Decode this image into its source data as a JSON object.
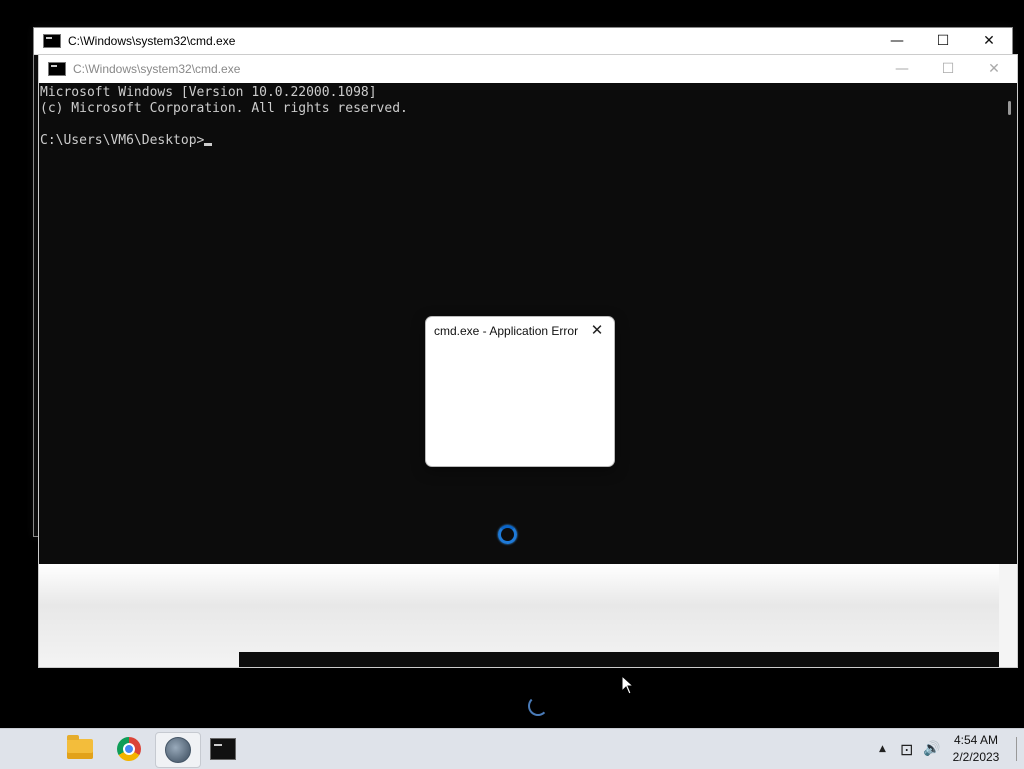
{
  "back_window": {
    "title": "C:\\Windows\\system32\\cmd.exe",
    "controls": {
      "minimize": "—",
      "maximize": "☐",
      "close": "✕"
    }
  },
  "front_window": {
    "title": "C:\\Windows\\system32\\cmd.exe",
    "controls": {
      "minimize": "—",
      "maximize": "☐",
      "close": "✕"
    },
    "console_lines": [
      "Microsoft Windows [Version 10.0.22000.1098]",
      "(c) Microsoft Corporation. All rights reserved.",
      "",
      "C:\\Users\\VM6\\Desktop>"
    ]
  },
  "dialog": {
    "title": "cmd.exe - Application Error",
    "close": "✕"
  },
  "taskbar": {
    "apps": [
      {
        "name": "File Explorer",
        "icon": "folder-icon"
      },
      {
        "name": "Google Chrome",
        "icon": "chrome-icon"
      },
      {
        "name": "Steam",
        "icon": "steam-icon",
        "active": true
      },
      {
        "name": "Command Prompt",
        "icon": "terminal-icon"
      }
    ],
    "tray": {
      "chevron": "▲",
      "network": "⊡",
      "volume": "🔊"
    },
    "clock": {
      "time": "4:54 AM",
      "date": "2/2/2023"
    }
  }
}
